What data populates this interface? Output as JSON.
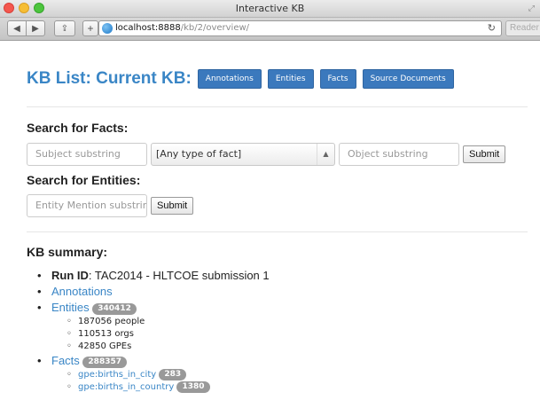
{
  "window": {
    "title": "Interactive KB",
    "url_host": "localhost:8888",
    "url_path": "/kb/2/overview/",
    "reader_label": "Reader"
  },
  "header": {
    "title": "KB List: Current KB:",
    "buttons": [
      "Annotations",
      "Entities",
      "Facts",
      "Source Documents"
    ]
  },
  "facts_search": {
    "heading": "Search for Facts:",
    "subject_placeholder": "Subject substring",
    "fact_type_selected": "[Any type of fact]",
    "object_placeholder": "Object substring",
    "submit_label": "Submit"
  },
  "entity_search": {
    "heading": "Search for Entities:",
    "mention_placeholder": "Entity Mention substring",
    "submit_label": "Submit"
  },
  "summary": {
    "heading": "KB summary:",
    "run_id_label": "Run ID",
    "run_id_value": ": TAC2014 - HLTCOE submission 1",
    "annotations_label": "Annotations",
    "entities_label": "Entities",
    "entities_count": "340412",
    "entity_breakdown": [
      "187056 people",
      "110513 orgs",
      "42850 GPEs"
    ],
    "facts_label": "Facts",
    "facts_count": "288357",
    "fact_types": [
      {
        "name": "gpe:births_in_city",
        "count": "283"
      },
      {
        "name": "gpe:births_in_country",
        "count": "1380"
      }
    ]
  },
  "colors": {
    "link": "#3a86c6",
    "button": "#3b79bd",
    "badge": "#999999"
  }
}
